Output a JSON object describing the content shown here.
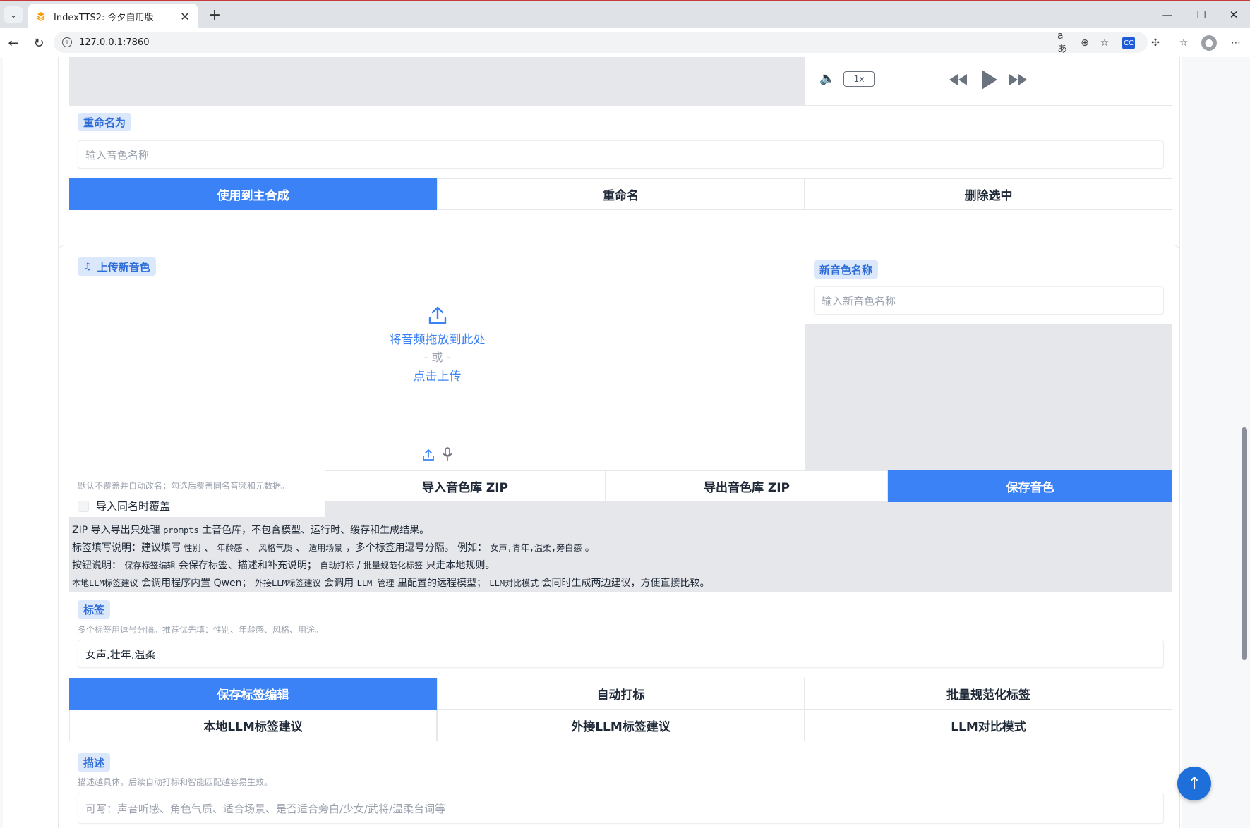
{
  "browser": {
    "tab_title": "IndexTTS2: 今夕自用版",
    "url": "127.0.0.1:7860"
  },
  "player": {
    "speed": "1x"
  },
  "rename": {
    "label": "重命名为",
    "placeholder": "输入音色名称",
    "buttons": [
      "使用到主合成",
      "重命名",
      "删除选中"
    ]
  },
  "upload": {
    "label": "上传新音色",
    "drop_text": "将音频拖放到此处",
    "or_text": "- 或 -",
    "click_text": "点击上传",
    "new_name_label": "新音色名称",
    "new_name_placeholder": "输入新音色名称"
  },
  "zip": {
    "overwrite_hint": "默认不覆盖并自动改名；勾选后覆盖同名音频和元数据。",
    "overwrite_label": "导入同名时覆盖",
    "import_label": "导入音色库 ZIP",
    "export_label": "导出音色库 ZIP",
    "save_label": "保存音色"
  },
  "notes": {
    "line1_a": "ZIP 导入导出只处理 ",
    "line1_code": "prompts",
    "line1_b": " 主音色库，不包含模型、运行时、缓存和生成结果。",
    "line2_a": "标签填写说明：建议填写 ",
    "line2_c1": "性别",
    "line2_s1": " 、 ",
    "line2_c2": "年龄感",
    "line2_s2": " 、 ",
    "line2_c3": "风格气质",
    "line2_s3": " 、 ",
    "line2_c4": "适用场景",
    "line2_b": " ，多个标签用逗号分隔。 例如： ",
    "line2_c5": "女声,青年,温柔,旁白感",
    "line2_end": " 。",
    "line3_a": "按钮说明： ",
    "line3_c1": "保存标签编辑",
    "line3_b": " 会保存标签、描述和补充说明； ",
    "line3_c2": "自动打标",
    "line3_s": " / ",
    "line3_c3": "批量规范化标签",
    "line3_d": " 只走本地规则。",
    "line4_c1": "本地LLM标签建议",
    "line4_a": " 会调用程序内置 Qwen； ",
    "line4_c2": "外接LLM标签建议",
    "line4_b": " 会调用 ",
    "line4_c3": "LLM 管理",
    "line4_c": " 里配置的远程模型； ",
    "line4_c4": "LLM对比模式",
    "line4_d": " 会同时生成两边建议，方便直接比较。"
  },
  "tags": {
    "label": "标签",
    "hint": "多个标签用逗号分隔。推荐优先填：性别、年龄感、风格、用途。",
    "value": "女声,壮年,温柔",
    "buttons_row1": [
      "保存标签编辑",
      "自动打标",
      "批量规范化标签"
    ],
    "buttons_row2": [
      "本地LLM标签建议",
      "外接LLM标签建议",
      "LLM对比模式"
    ]
  },
  "description": {
    "label": "描述",
    "hint": "描述越具体，后续自动打标和智能匹配越容易生效。",
    "placeholder": "可写：声音听感、角色气质、适合场景、是否适合旁白/少女/武将/温柔台词等"
  },
  "colors": {
    "primary": "#3b82f6",
    "chip_bg": "#dbe8fb",
    "chip_text": "#2f6ed8"
  }
}
